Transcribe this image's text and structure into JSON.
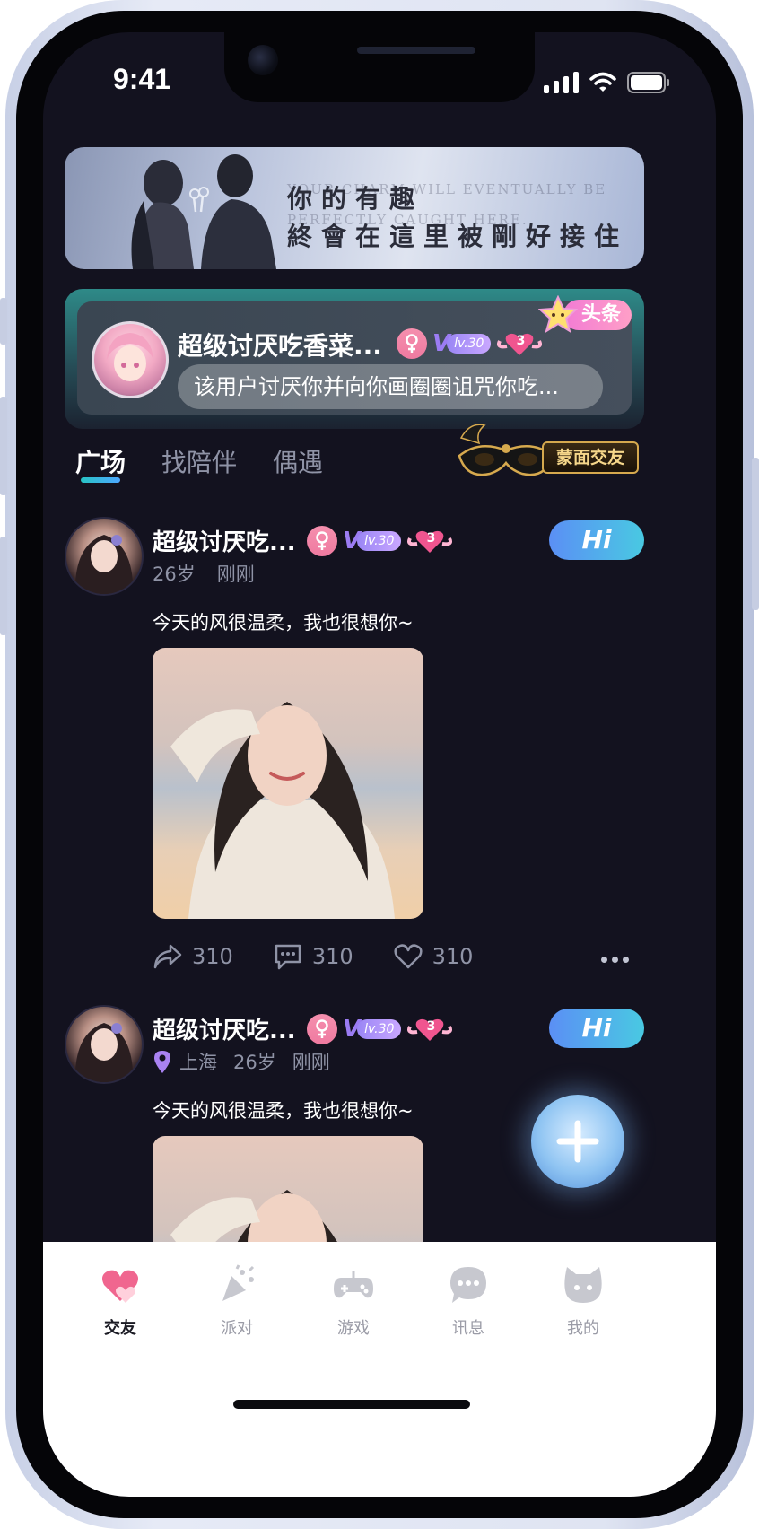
{
  "status_bar": {
    "time": "9:41"
  },
  "banner": {
    "line1": "你的有趣",
    "line2": "終會在這里被剛好接住",
    "english": "YOUR CHARM WILL EVENTUALLY BE PERFECTLY CAUGHT HERE."
  },
  "headline": {
    "name": "超级讨厌吃香菜...",
    "level": "lv.30",
    "heart_count": "3",
    "message": "该用户讨厌你并向你画圈圈诅咒你吃...",
    "tag": "头条"
  },
  "tabs": [
    {
      "label": "广场",
      "active": true
    },
    {
      "label": "找陪伴",
      "active": false
    },
    {
      "label": "偶遇",
      "active": false
    }
  ],
  "masked_dating": {
    "label": "蒙面交友"
  },
  "posts": [
    {
      "name": "超级讨厌吃...",
      "level": "lv.30",
      "heart_count": "3",
      "location": "",
      "age": "26岁",
      "time": "刚刚",
      "hi": "Hi",
      "text": "今天的风很温柔，我也很想你~",
      "shares": "310",
      "comments": "310",
      "likes": "310"
    },
    {
      "name": "超级讨厌吃...",
      "level": "lv.30",
      "heart_count": "3",
      "location": "上海",
      "age": "26岁",
      "time": "刚刚",
      "hi": "Hi",
      "text": "今天的风很温柔，我也很想你~"
    }
  ],
  "tabbar": [
    {
      "label": "交友",
      "icon": "heart-icon",
      "active": true
    },
    {
      "label": "派对",
      "icon": "party-popper-icon",
      "active": false
    },
    {
      "label": "游戏",
      "icon": "gamepad-icon",
      "active": false
    },
    {
      "label": "讯息",
      "icon": "chat-bubble-icon",
      "active": false
    },
    {
      "label": "我的",
      "icon": "cat-face-icon",
      "active": false
    }
  ],
  "colors": {
    "background": "#13121f",
    "accent_teal": "#28c3c4",
    "hi_gradient_start": "#5b8ff5",
    "hi_gradient_end": "#49c9e2",
    "female_badge": "#f58fae",
    "level_purple": "#9b7cf3",
    "tabbar_active_pink": "#f0668f"
  }
}
